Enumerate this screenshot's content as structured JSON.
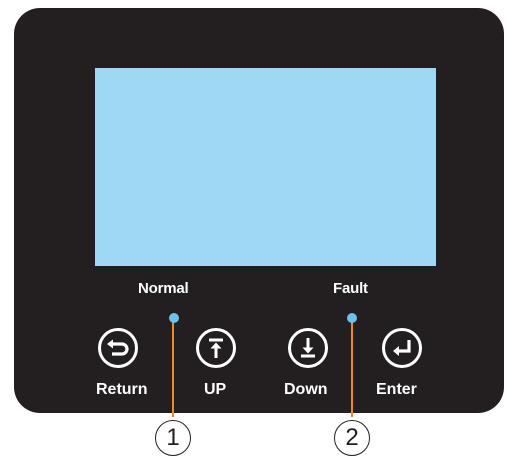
{
  "indicators": {
    "normal": {
      "label": "Normal",
      "color": "#6bc1f0"
    },
    "fault": {
      "label": "Fault",
      "color": "#6bc1f0"
    }
  },
  "buttons": [
    {
      "label": "Return",
      "icon": "return-arrow-icon"
    },
    {
      "label": "UP",
      "icon": "up-to-top-icon"
    },
    {
      "label": "Down",
      "icon": "down-to-bottom-icon"
    },
    {
      "label": "Enter",
      "icon": "enter-icon"
    }
  ],
  "callouts": [
    "1",
    "2"
  ],
  "colors": {
    "panel": "#231f20",
    "screen": "#9fd8f4",
    "leader": "#f08a1c"
  }
}
